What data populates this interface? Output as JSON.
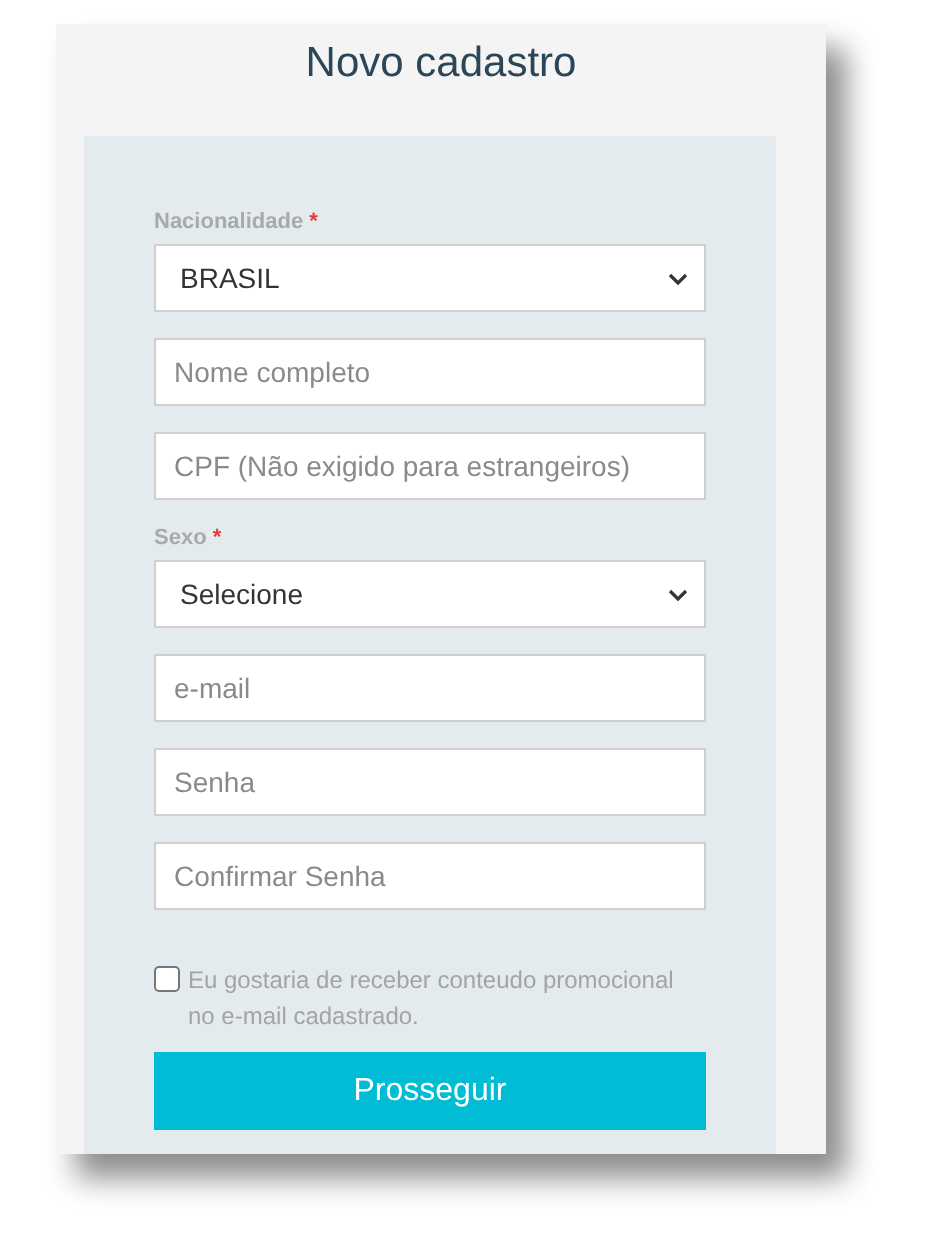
{
  "title": "Novo cadastro",
  "fields": [
    {
      "kind": "select",
      "label": "Nacionalidade",
      "required": true,
      "value": "BRASIL"
    },
    {
      "kind": "text",
      "placeholder": "Nome completo"
    },
    {
      "kind": "text",
      "placeholder": "CPF (Não exigido para estrangeiros)"
    },
    {
      "kind": "select",
      "label": "Sexo",
      "required": true,
      "value": "Selecione"
    },
    {
      "kind": "text",
      "placeholder": "e-mail"
    },
    {
      "kind": "text",
      "placeholder": "Senha"
    },
    {
      "kind": "text",
      "placeholder": "Confirmar Senha"
    }
  ],
  "consent": {
    "label": "Eu gostaria de receber conteudo promocional no e-mail cadastrado.",
    "checked": false
  },
  "submit": "Prosseguir",
  "required_mark": "*"
}
